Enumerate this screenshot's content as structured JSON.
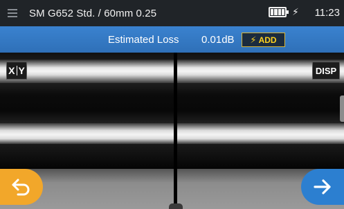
{
  "header": {
    "fiber_profile": "SM G652 Std. / 60mm 0.25",
    "time": "11:23",
    "battery_icon": "battery-full-icon",
    "charging_icon": "charging-bolt-icon",
    "charging_glyph": "⚡"
  },
  "loss_bar": {
    "label": "Estimated Loss",
    "value": "0.01dB",
    "add_label": "ADD",
    "add_icon": "lightning-icon"
  },
  "view": {
    "xy_left": "X",
    "xy_right": "Y",
    "disp_label": "DISP"
  },
  "nav": {
    "back_icon": "back-arrow-icon",
    "next_icon": "next-arrow-icon"
  },
  "colors": {
    "header_bg": "#202428",
    "loss_bar_bg": "#3a82cf",
    "back_button": "#f2a72a",
    "next_button": "#2c7fd0",
    "add_text": "#ffd21f"
  }
}
